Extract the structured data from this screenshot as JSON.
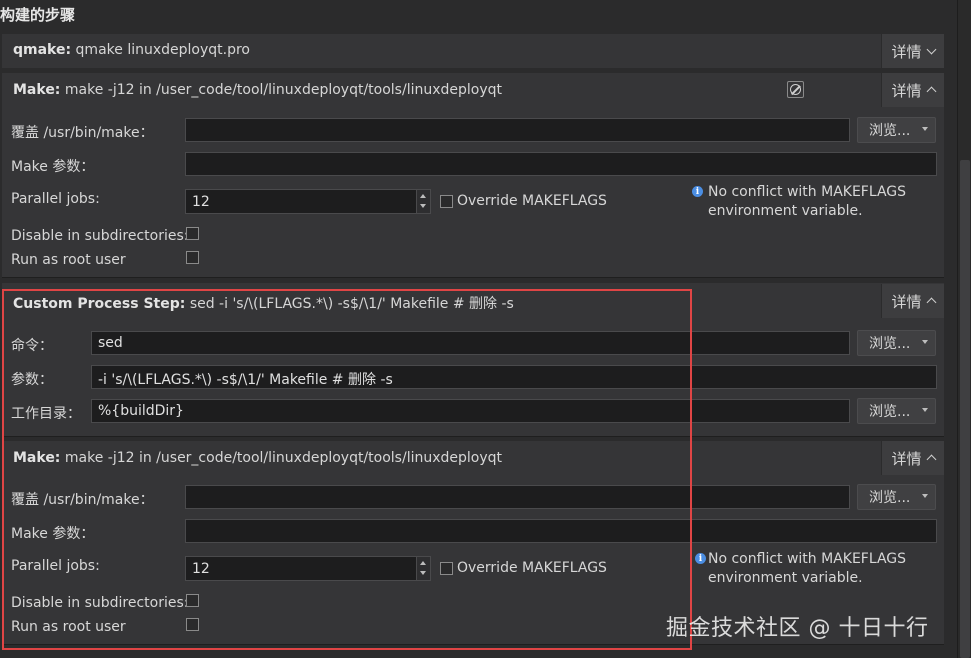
{
  "section_title": "构建的步骤",
  "details_label": "详情",
  "qmake_step": {
    "title": "qmake:",
    "command": "qmake linuxdeployqt.pro"
  },
  "make_step_1": {
    "title": "Make:",
    "command": "make -j12 in /user_code/tool/linuxdeployqt/tools/linuxdeployqt",
    "override_label": "覆盖 /usr/bin/make：",
    "override_value": "",
    "browse_label": "浏览...",
    "args_label": "Make 参数：",
    "args_value": "",
    "jobs_label": "Parallel jobs:",
    "jobs_value": "12",
    "override_makeflags_label": "Override MAKEFLAGS",
    "info_line1": "No conflict with MAKEFLAGS",
    "info_line2": "environment variable.",
    "disable_subdirs_label": "Disable in subdirectories:",
    "run_root_label": "Run as root user"
  },
  "custom_step": {
    "title": "Custom Process Step:",
    "summary": "sed -i 's/\\(LFLAGS.*\\) -s$/\\1/' Makefile # 删除 -s",
    "command_label": "命令：",
    "command_value": "sed",
    "browse_label": "浏览...",
    "args_label": "参数：",
    "args_value": "-i 's/\\(LFLAGS.*\\) -s$/\\1/' Makefile  # 删除 -s",
    "workdir_label": "工作目录：",
    "workdir_value": "%{buildDir}"
  },
  "make_step_2": {
    "title": "Make:",
    "command": "make -j12 in /user_code/tool/linuxdeployqt/tools/linuxdeployqt",
    "override_label": "覆盖 /usr/bin/make：",
    "override_value": "",
    "browse_label": "浏览...",
    "args_label": "Make 参数：",
    "args_value": "",
    "jobs_label": "Parallel jobs:",
    "jobs_value": "12",
    "override_makeflags_label": "Override MAKEFLAGS",
    "info_line1": "No conflict with MAKEFLAGS",
    "info_line2": "environment variable.",
    "disable_subdirs_label": "Disable in subdirectories:",
    "run_root_label": "Run as root user"
  },
  "watermark": "掘金技术社区 @ 十日十行",
  "colors": {
    "background": "#2b2b2c",
    "panel": "#353537",
    "field": "#1d1d1e",
    "highlight": "#e04545",
    "info": "#4b8ee3"
  },
  "icons": [
    "chevron-down-icon",
    "chevron-up-icon",
    "disable-step-icon",
    "info-icon",
    "dropdown-arrow-icon"
  ]
}
